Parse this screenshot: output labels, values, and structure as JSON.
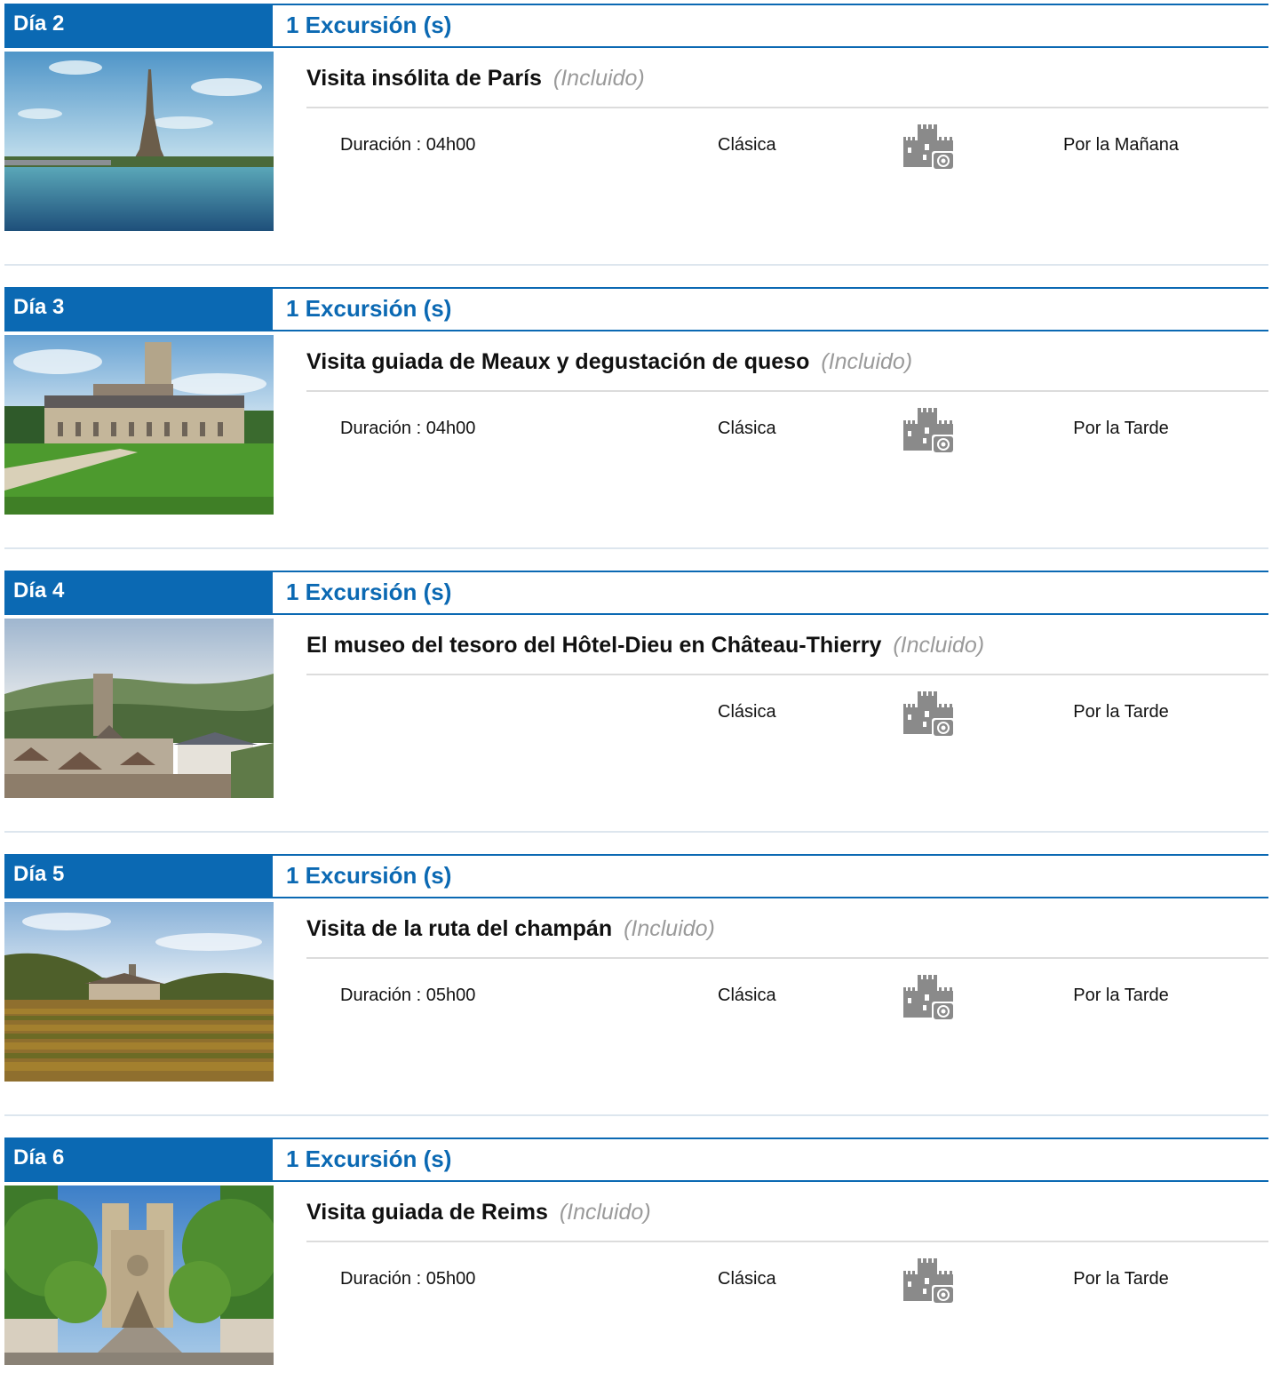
{
  "days": [
    {
      "day_label": "Día 2",
      "excursions_label": "1 Excursión (s)",
      "title": "Visita insólita de París",
      "included": "(Incluido)",
      "duration": "Duración : 04h00",
      "category": "Clásica",
      "icon": "castle-camera-icon",
      "time_of_day": "Por la Mañana",
      "image": "eiffel-tower-seine-photo"
    },
    {
      "day_label": "Día 3",
      "excursions_label": "1 Excursión (s)",
      "title": "Visita guiada de Meaux y degustación de queso",
      "included": "(Incluido)",
      "duration": "Duración : 04h00",
      "category": "Clásica",
      "icon": "castle-camera-icon",
      "time_of_day": "Por la Tarde",
      "image": "meaux-cathedral-garden-photo"
    },
    {
      "day_label": "Día 4",
      "excursions_label": "1 Excursión (s)",
      "title": "El museo del tesoro del Hôtel-Dieu en Château-Thierry",
      "included": "(Incluido)",
      "duration": "",
      "category": "Clásica",
      "icon": "castle-camera-icon",
      "time_of_day": "Por la Tarde",
      "image": "chateau-thierry-town-photo"
    },
    {
      "day_label": "Día 5",
      "excursions_label": "1 Excursión (s)",
      "title": "Visita de la ruta del champán",
      "included": "(Incluido)",
      "duration": "Duración : 05h00",
      "category": "Clásica",
      "icon": "castle-camera-icon",
      "time_of_day": "Por la Tarde",
      "image": "champagne-vineyard-photo"
    },
    {
      "day_label": "Día 6",
      "excursions_label": "1 Excursión (s)",
      "title": "Visita guiada de Reims",
      "included": "(Incluido)",
      "duration": "Duración : 05h00",
      "category": "Clásica",
      "icon": "castle-camera-icon",
      "time_of_day": "Por la Tarde",
      "image": "reims-cathedral-street-photo"
    }
  ],
  "colors": {
    "accent": "#0b69b3",
    "included": "#9a9a9a",
    "icon": "#8a8a8a"
  }
}
